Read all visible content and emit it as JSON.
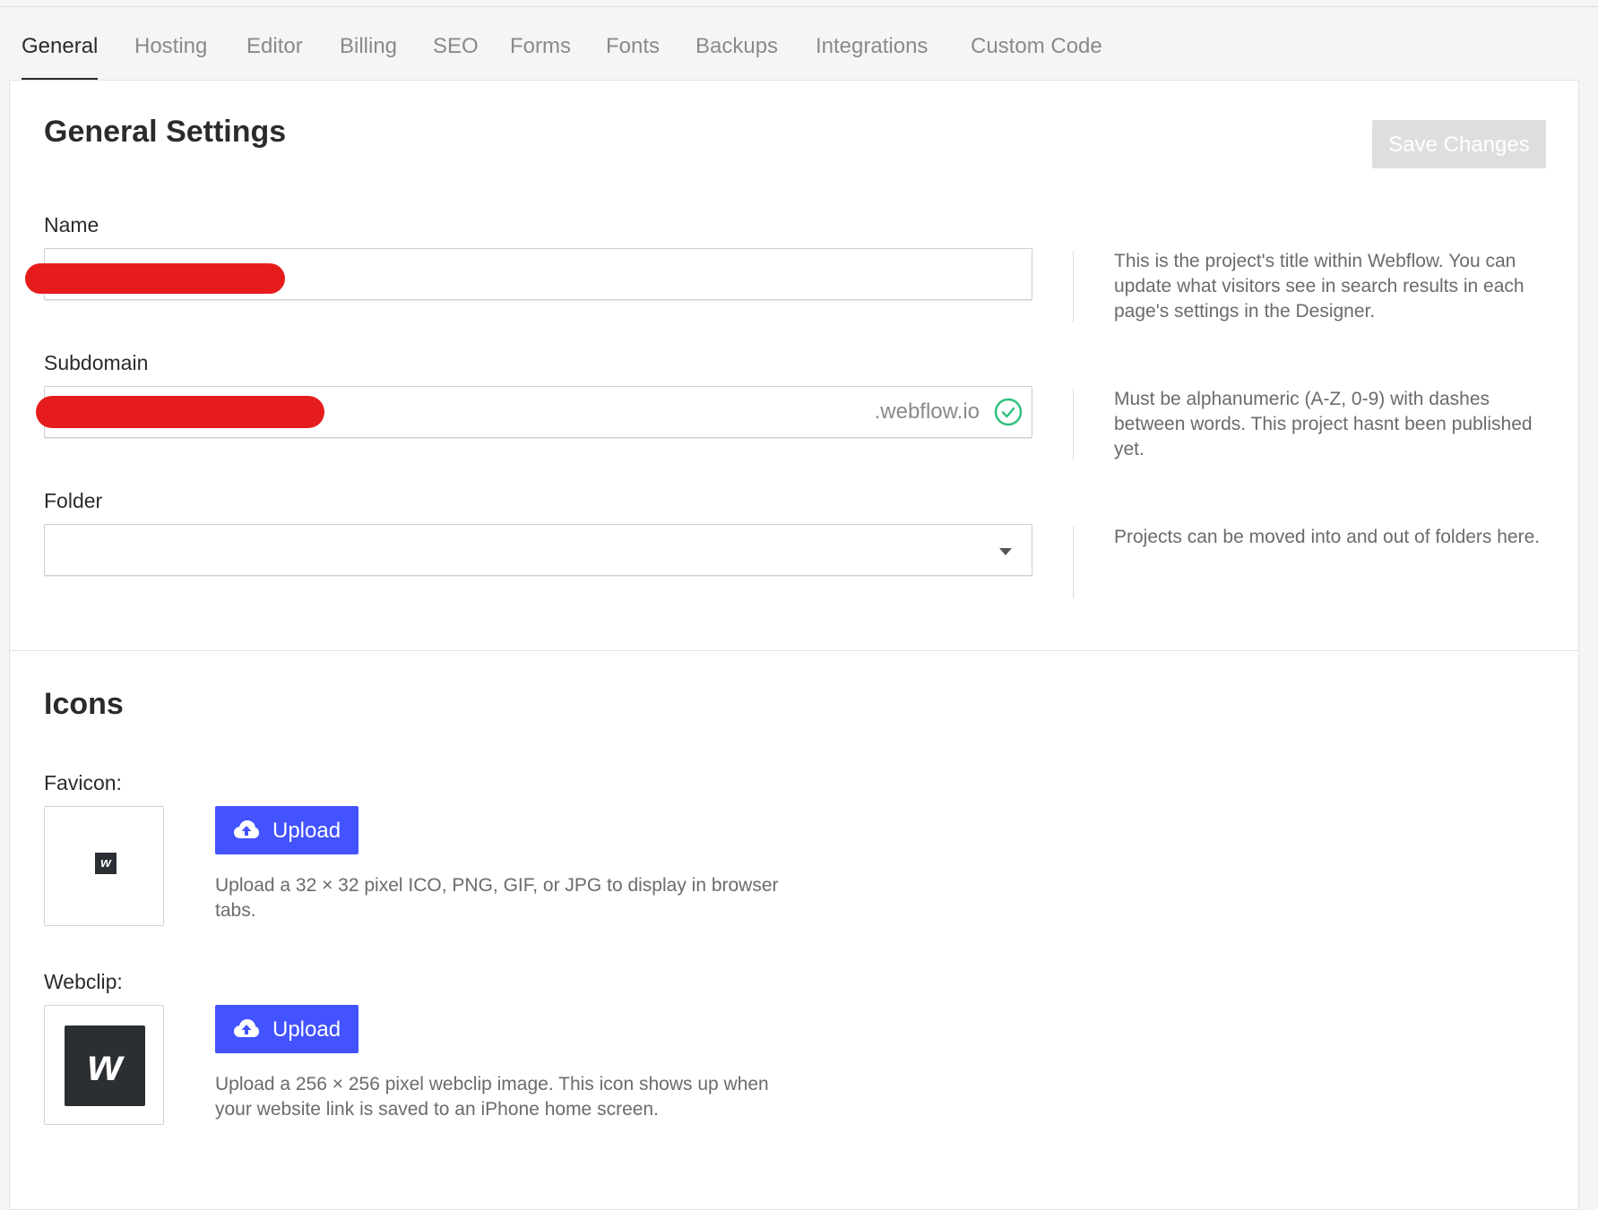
{
  "tabs": [
    {
      "label": "General",
      "active": true
    },
    {
      "label": "Hosting"
    },
    {
      "label": "Editor"
    },
    {
      "label": "Billing"
    },
    {
      "label": "SEO"
    },
    {
      "label": "Forms"
    },
    {
      "label": "Fonts"
    },
    {
      "label": "Backups"
    },
    {
      "label": "Integrations"
    },
    {
      "label": "Custom Code"
    }
  ],
  "general": {
    "title": "General Settings",
    "save_label": "Save Changes",
    "name": {
      "label": "Name",
      "help": "This is the project's title within Webflow. You can update what visitors see in search results in each page's settings in the Designer."
    },
    "subdomain": {
      "label": "Subdomain",
      "suffix": ".webflow.io",
      "help": "Must be alphanumeric (A-Z, 0-9) with dashes between words. This project hasnt been published yet."
    },
    "folder": {
      "label": "Folder",
      "help": "Projects can be moved into and out of folders here."
    }
  },
  "icons": {
    "title": "Icons",
    "favicon": {
      "label": "Favicon:",
      "upload_label": "Upload",
      "help": "Upload a 32 × 32 pixel ICO, PNG, GIF, or JPG to display in browser tabs.",
      "mark": "w"
    },
    "webclip": {
      "label": "Webclip:",
      "upload_label": "Upload",
      "help": "Upload a 256 × 256 pixel webclip image. This icon shows up when your website link is saved to an iPhone home screen.",
      "mark": "w"
    }
  },
  "colors": {
    "accent": "#4353ff",
    "success": "#2ec27e",
    "redaction": "#e61c1c"
  }
}
